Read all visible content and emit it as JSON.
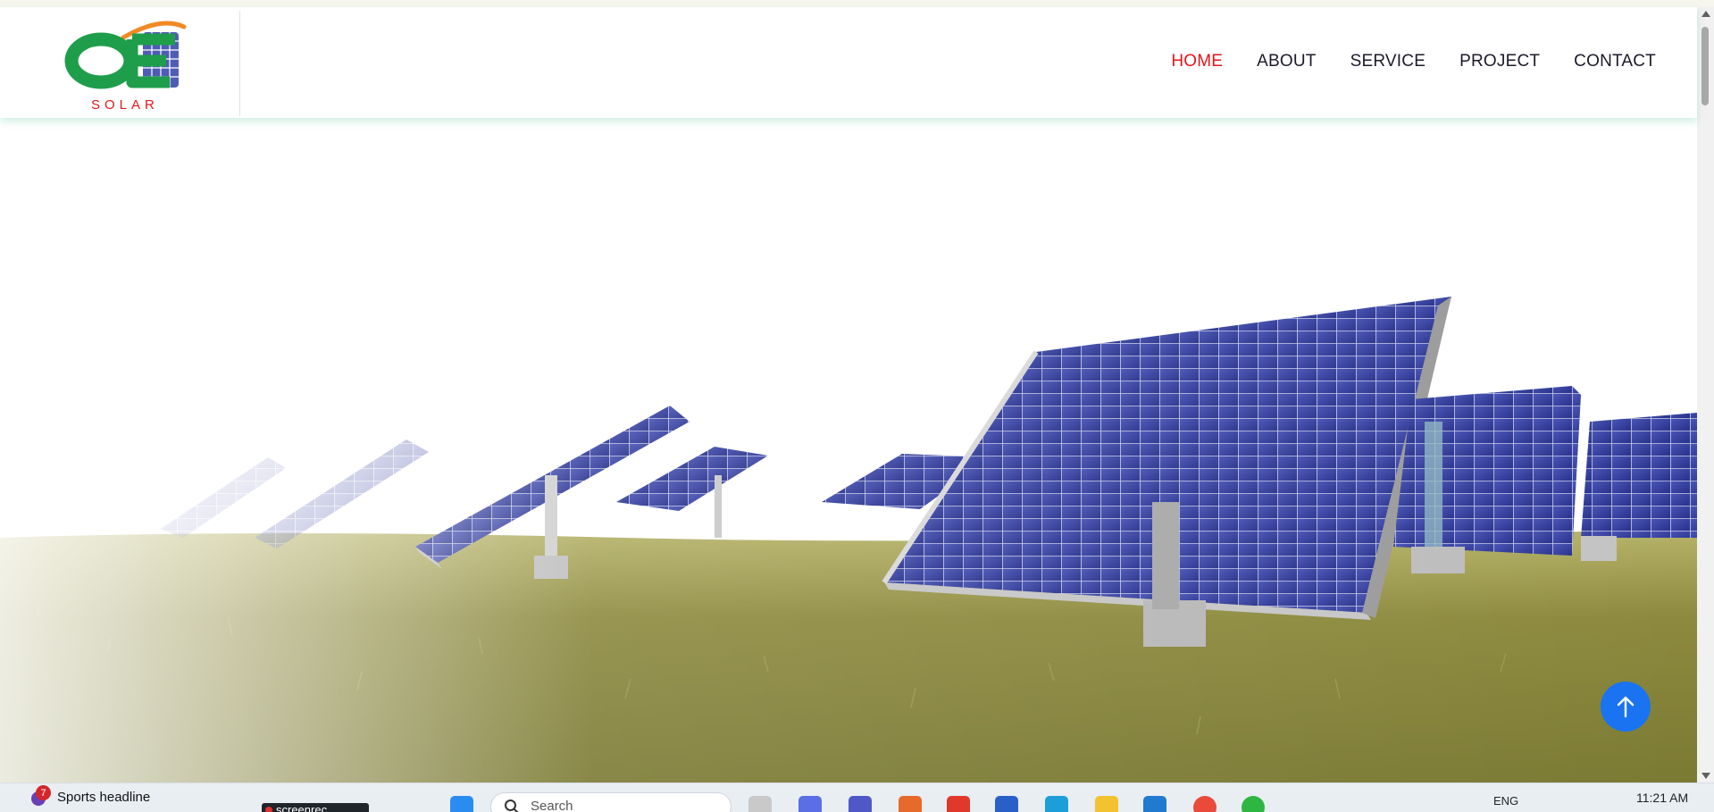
{
  "brand": {
    "logo_letters": "OE",
    "logo_subtitle": "SOLAR",
    "colors": {
      "green": "#1e9e4a",
      "red": "#e1161d",
      "blue": "#2f3fa8",
      "orange": "#f08a24"
    }
  },
  "nav": {
    "items": [
      {
        "label": "HOME",
        "active": true
      },
      {
        "label": "ABOUT",
        "active": false
      },
      {
        "label": "SERVICE",
        "active": false
      },
      {
        "label": "PROJECT",
        "active": false
      },
      {
        "label": "CONTACT",
        "active": false
      }
    ],
    "active_color": "#e1161d"
  },
  "hero": {
    "image": "solar-panels-on-grass-field"
  },
  "back_to_top": {
    "icon": "arrow-up-icon",
    "color": "#1a73f0"
  },
  "taskbar": {
    "news_label": "Sports headline",
    "news_badge": "7",
    "recorder_label": "screenrec",
    "search_placeholder": "Search",
    "language": "ENG",
    "time": "11:21 AM"
  }
}
